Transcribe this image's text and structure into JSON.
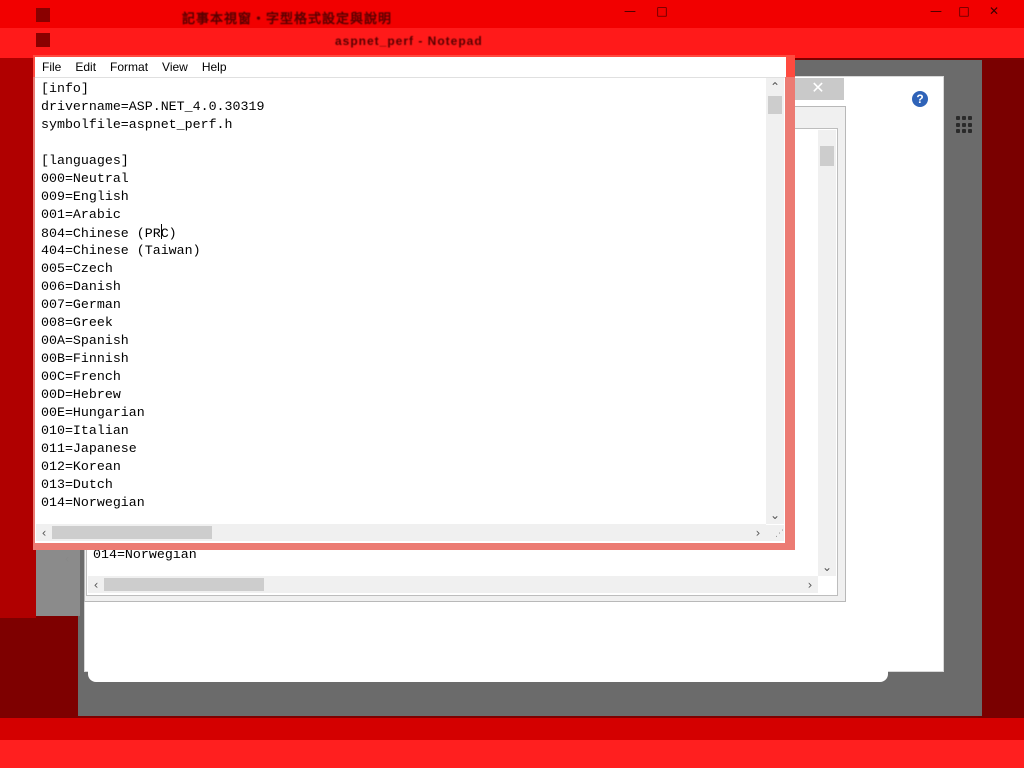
{
  "background_window": {
    "title_garbled": "記事本視窗・字型格式設定與說明",
    "subtitle_garbled": "aspnet_perf - Notepad",
    "controls": [
      "—",
      "□",
      "✕"
    ]
  },
  "back_dialog": {
    "close_glyph": "✕",
    "help_glyph": "?"
  },
  "middle_notepad": {
    "visible_line": "014=Norwegian"
  },
  "notepad": {
    "menu": [
      "File",
      "Edit",
      "Format",
      "View",
      "Help"
    ],
    "lines": [
      "[info]",
      "drivername=ASP.NET_4.0.30319",
      "symbolfile=aspnet_perf.h",
      "",
      "[languages]",
      "000=Neutral",
      "009=English",
      "001=Arabic",
      "804=Chinese (PRC)",
      "404=Chinese (Taiwan)",
      "005=Czech",
      "006=Danish",
      "007=German",
      "008=Greek",
      "00A=Spanish",
      "00B=Finnish",
      "00C=French",
      "00D=Hebrew",
      "00E=Hungarian",
      "010=Italian",
      "011=Japanese",
      "012=Korean",
      "013=Dutch",
      "014=Norwegian"
    ],
    "caret": {
      "line": 8,
      "column": 15
    }
  },
  "icons": {
    "scroll_up": "chevron-up-icon",
    "scroll_down": "chevron-down-icon",
    "scroll_left": "chevron-left-icon",
    "scroll_right": "chevron-right-icon",
    "help": "help-icon",
    "apps": "grid-icon",
    "close": "close-icon"
  },
  "colors": {
    "desktop_red": "#f20000",
    "dark_red": "#7e0000",
    "frame_accent": "#ec7b73",
    "help_blue": "#2f63b8"
  }
}
